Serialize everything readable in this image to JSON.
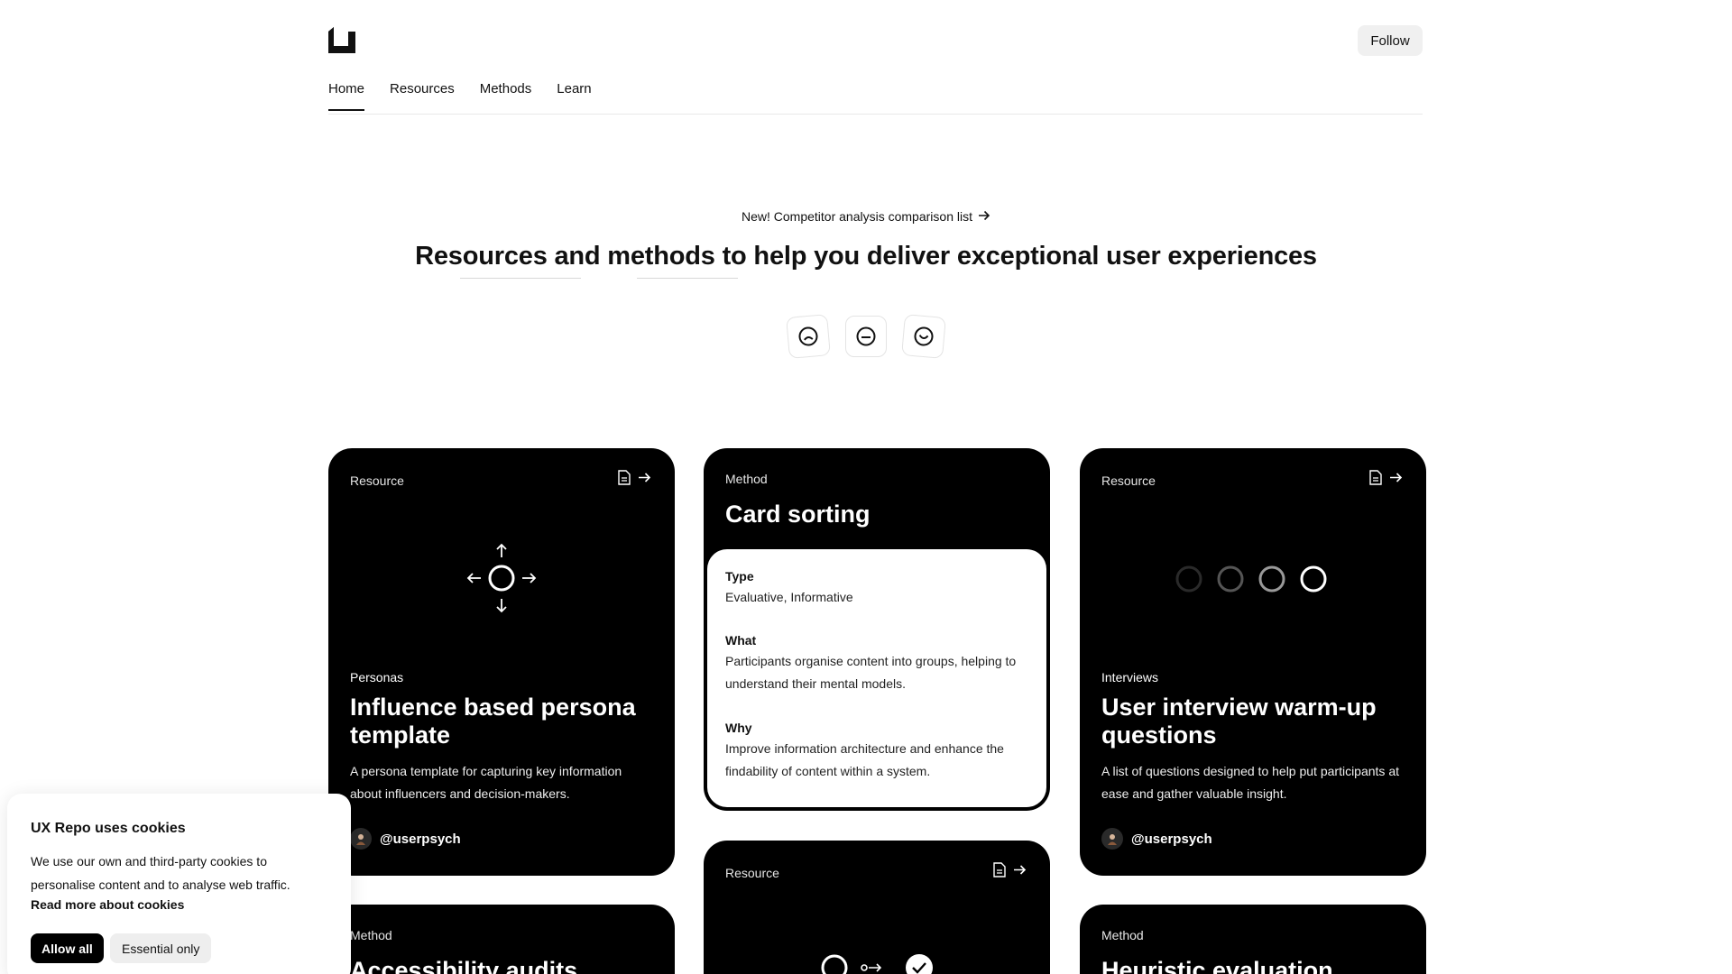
{
  "header": {
    "follow_label": "Follow",
    "nav": [
      {
        "label": "Home",
        "active": true
      },
      {
        "label": "Resources"
      },
      {
        "label": "Methods"
      },
      {
        "label": "Learn"
      }
    ]
  },
  "hero": {
    "announcement": "New! Competitor analysis comparison list",
    "headline": "Resources and methods to help you deliver exceptional user experiences",
    "feedback_icons": [
      "sad-face-icon",
      "neutral-face-icon",
      "happy-face-icon"
    ]
  },
  "cards": {
    "persona": {
      "kind": "Resource",
      "category": "Personas",
      "title": "Influence based persona template",
      "description": "A persona template for capturing key information about influencers and decision-makers.",
      "author": "@userpsych"
    },
    "card_sorting": {
      "kind": "Method",
      "title": "Card sorting",
      "type_label": "Type",
      "type_value": "Evaluative, Informative",
      "what_label": "What",
      "what_value": "Participants organise content into groups, helping to understand their mental models.",
      "why_label": "Why",
      "why_value": "Improve information architecture and enhance the findability of content within a system."
    },
    "interview": {
      "kind": "Resource",
      "category": "Interviews",
      "title": "User interview warm-up questions",
      "description": "A list of questions designed to help put participants at ease and gather valuable insight.",
      "author": "@userpsych"
    },
    "accessibility": {
      "kind": "Method",
      "title": "Accessibility audits"
    },
    "resource_mid": {
      "kind": "Resource"
    },
    "heuristic": {
      "kind": "Method",
      "title": "Heuristic evaluation"
    }
  },
  "cookie": {
    "title": "UX Repo uses cookies",
    "body": "We use our own and third-party cookies to personalise content and to analyse web traffic.",
    "read_more": "Read more about cookies",
    "allow_all": "Allow all",
    "essential_only": "Essential only"
  },
  "colors": {
    "card_bg": "#000000",
    "page_bg": "#ffffff",
    "follow_bg": "#f0f0f0"
  }
}
